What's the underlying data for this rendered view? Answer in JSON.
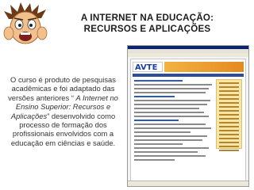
{
  "title": {
    "line1": "A  INTERNET NA EDUCAÇÃO:",
    "line2": "RECURSOS E APLICAÇÕES"
  },
  "description": {
    "part1": "O curso é produto de pesquisas acadêmicas e foi adaptado das versões anteriores “ ",
    "italic": "A Internet no Ensino Superior: Recursos e Aplicações",
    "part2": "” desenvolvido como processo de formação dos profissionais envolvidos com a educação em ciências e saúde."
  },
  "screenshot": {
    "logo_text": "AVTE"
  }
}
